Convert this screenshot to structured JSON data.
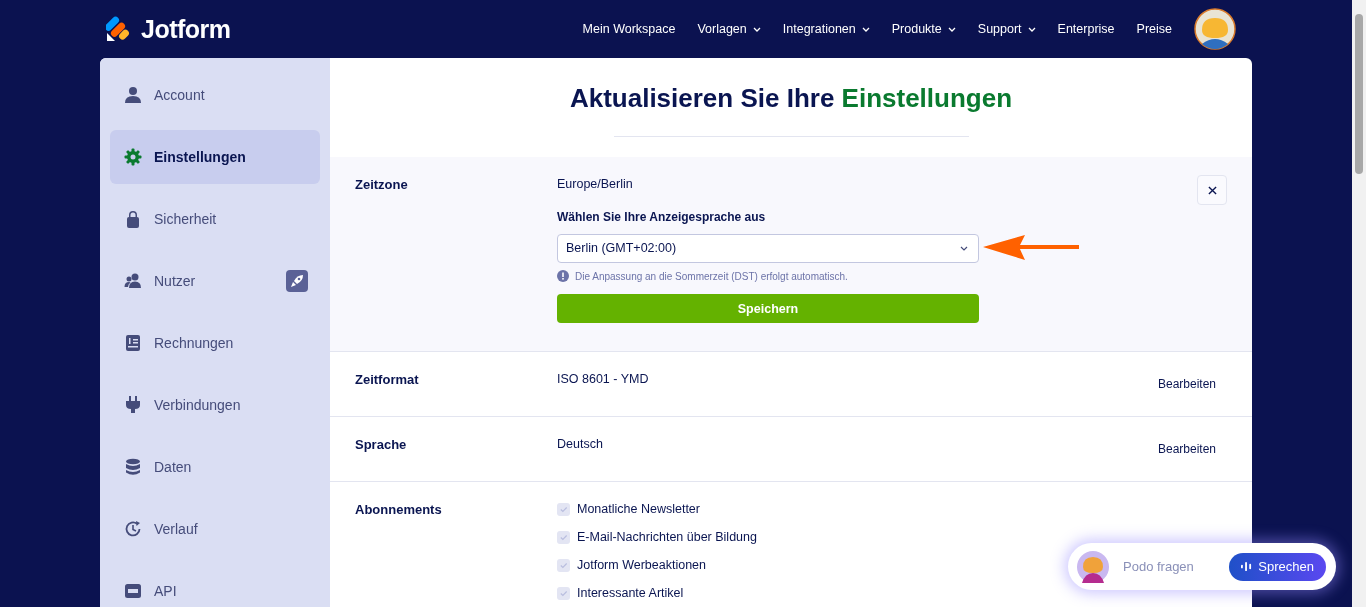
{
  "header": {
    "logo": "Jotform",
    "nav": [
      {
        "label": "Mein Workspace",
        "dropdown": false
      },
      {
        "label": "Vorlagen",
        "dropdown": true
      },
      {
        "label": "Integrationen",
        "dropdown": true
      },
      {
        "label": "Produkte",
        "dropdown": true
      },
      {
        "label": "Support",
        "dropdown": true
      },
      {
        "label": "Enterprise",
        "dropdown": false
      },
      {
        "label": "Preise",
        "dropdown": false
      }
    ]
  },
  "sidebar": {
    "items": [
      {
        "label": "Account",
        "selected": false,
        "badge": false
      },
      {
        "label": "Einstellungen",
        "selected": true,
        "badge": false
      },
      {
        "label": "Sicherheit",
        "selected": false,
        "badge": false
      },
      {
        "label": "Nutzer",
        "selected": false,
        "badge": true
      },
      {
        "label": "Rechnungen",
        "selected": false,
        "badge": false
      },
      {
        "label": "Verbindungen",
        "selected": false,
        "badge": false
      },
      {
        "label": "Daten",
        "selected": false,
        "badge": false
      },
      {
        "label": "Verlauf",
        "selected": false,
        "badge": false
      },
      {
        "label": "API",
        "selected": false,
        "badge": false
      }
    ]
  },
  "title": {
    "text": "Aktualisieren Sie Ihre ",
    "highlight": "Einstellungen"
  },
  "sections": [
    {
      "kind": "timezone",
      "label": "Zeitzone",
      "value": "Europe/Berlin",
      "select_label": "Wählen Sie Ihre Anzeigesprache aus",
      "select_value": "Berlin (GMT+02:00)",
      "hint": "Die Anpassung an die Sommerzeit (DST) erfolgt automatisch.",
      "save": "Speichern"
    },
    {
      "kind": "setting",
      "label": "Zeitformat",
      "value": "ISO 8601 - YMD",
      "action": "Bearbeiten"
    },
    {
      "kind": "setting",
      "label": "Sprache",
      "value": "Deutsch",
      "action": "Bearbeiten"
    },
    {
      "kind": "checklist",
      "label": "Abonnements",
      "options": [
        {
          "label": "Monatliche Newsletter",
          "checked": true,
          "disabled": true
        },
        {
          "label": "E-Mail-Nachrichten über Bildung",
          "checked": true,
          "disabled": true
        },
        {
          "label": "Jotform Werbeaktionen",
          "checked": true,
          "disabled": true
        },
        {
          "label": "Interessante Artikel",
          "checked": true,
          "disabled": true
        }
      ]
    }
  ],
  "assistant": {
    "placeholder": "Podo fragen",
    "button": "Sprechen"
  }
}
